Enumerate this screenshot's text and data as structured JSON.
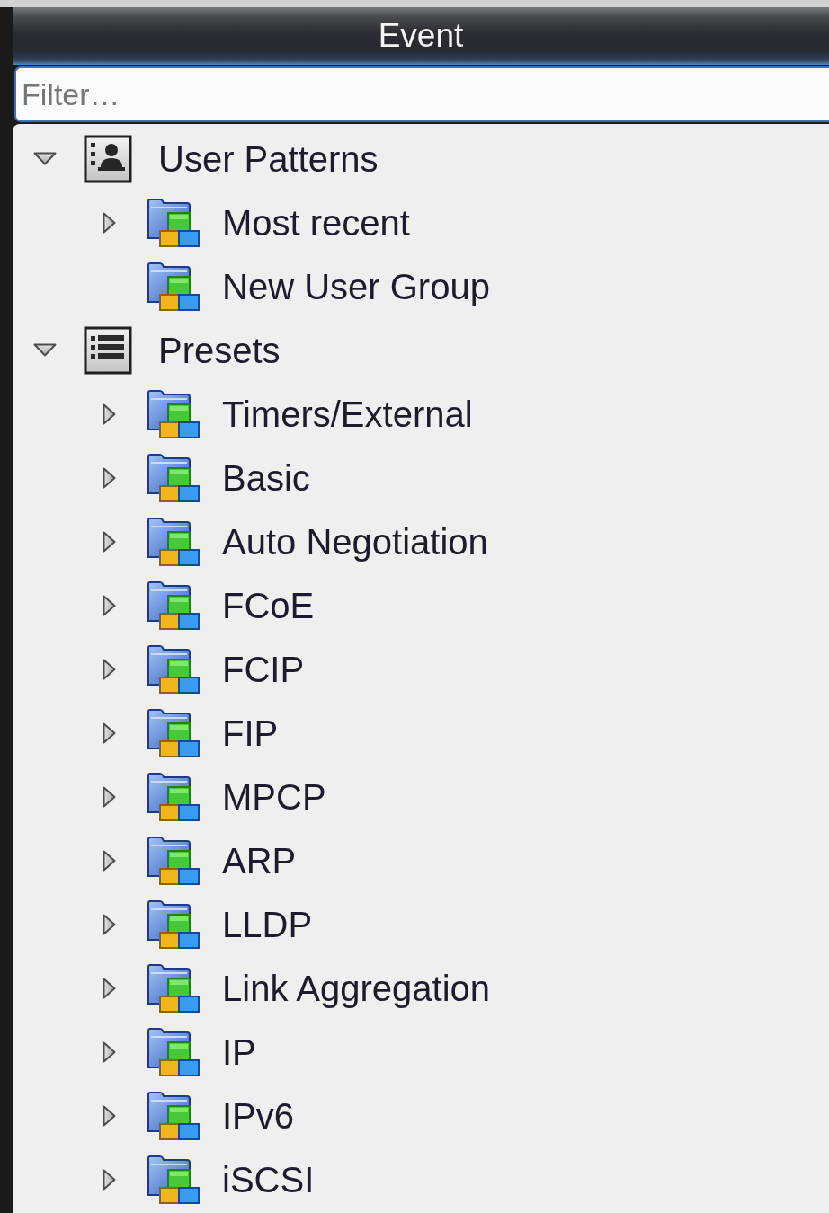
{
  "panel": {
    "title": "Event"
  },
  "filter": {
    "placeholder": "Filter…"
  },
  "tree": [
    {
      "label": "User Patterns",
      "kind": "users",
      "expandable": true,
      "expanded": true,
      "selected": false,
      "children": [
        {
          "label": "Most recent",
          "kind": "group",
          "expandable": true,
          "expanded": false,
          "selected": false
        },
        {
          "label": "New User Group",
          "kind": "group",
          "expandable": false,
          "expanded": false,
          "selected": false
        }
      ]
    },
    {
      "label": "Presets",
      "kind": "presets",
      "expandable": true,
      "expanded": true,
      "selected": false,
      "children": [
        {
          "label": "Timers/External",
          "kind": "group",
          "expandable": true,
          "expanded": false,
          "selected": false
        },
        {
          "label": "Basic",
          "kind": "group",
          "expandable": true,
          "expanded": false,
          "selected": false
        },
        {
          "label": "Auto Negotiation",
          "kind": "group",
          "expandable": true,
          "expanded": false,
          "selected": false
        },
        {
          "label": "FCoE",
          "kind": "group",
          "expandable": true,
          "expanded": false,
          "selected": false
        },
        {
          "label": "FCIP",
          "kind": "group",
          "expandable": true,
          "expanded": false,
          "selected": false
        },
        {
          "label": "FIP",
          "kind": "group",
          "expandable": true,
          "expanded": false,
          "selected": false
        },
        {
          "label": "MPCP",
          "kind": "group",
          "expandable": true,
          "expanded": false,
          "selected": false
        },
        {
          "label": "ARP",
          "kind": "group",
          "expandable": true,
          "expanded": false,
          "selected": false
        },
        {
          "label": "LLDP",
          "kind": "group",
          "expandable": true,
          "expanded": false,
          "selected": false
        },
        {
          "label": "Link Aggregation",
          "kind": "group",
          "expandable": true,
          "expanded": false,
          "selected": false
        },
        {
          "label": "IP",
          "kind": "group",
          "expandable": true,
          "expanded": false,
          "selected": false
        },
        {
          "label": "IPv6",
          "kind": "group",
          "expandable": true,
          "expanded": false,
          "selected": false
        },
        {
          "label": "iSCSI",
          "kind": "group",
          "expandable": true,
          "expanded": false,
          "selected": false
        }
      ]
    }
  ]
}
